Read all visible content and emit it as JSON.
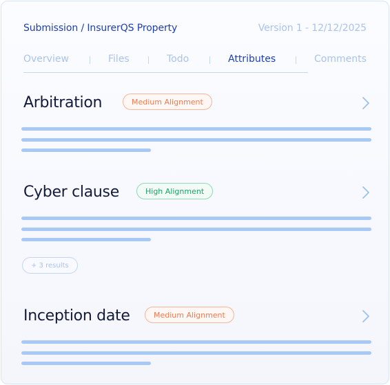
{
  "header": {
    "breadcrumb": "Submission / InsurerQS Property",
    "version": "Version 1 - 12/12/2025"
  },
  "tabs": [
    {
      "label": "Overview",
      "active": false
    },
    {
      "label": "Files",
      "active": false
    },
    {
      "label": "Todo",
      "active": false
    },
    {
      "label": "Attributes",
      "active": true
    },
    {
      "label": "Comments",
      "active": false
    }
  ],
  "attributes": [
    {
      "title": "Arbitration",
      "alignment": "Medium Alignment",
      "level": "medium"
    },
    {
      "title": "Cyber clause",
      "alignment": "High Alignment",
      "level": "high",
      "more_results": "+ 3 results"
    },
    {
      "title": "Inception date",
      "alignment": "Medium Alignment",
      "level": "medium"
    }
  ],
  "colors": {
    "primary": "#1e3fae",
    "muted": "#a9c3ee",
    "medium_alignment": "#ef7a52",
    "high_alignment": "#1ea066",
    "placeholder_bar": "#a8c8f5"
  },
  "icons": {
    "expand": "chevron-right-icon"
  }
}
